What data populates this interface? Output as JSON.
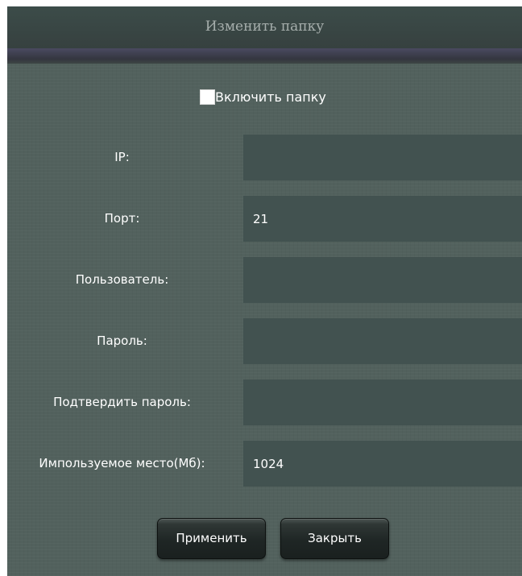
{
  "dialog": {
    "title": "Изменить папку",
    "enable": {
      "label": "Включить папку",
      "checked": false
    },
    "fields": [
      {
        "label": "IP:",
        "value": ""
      },
      {
        "label": "Порт:",
        "value": "21"
      },
      {
        "label": "Пользователь:",
        "value": ""
      },
      {
        "label": "Пароль:",
        "value": ""
      },
      {
        "label": "Подтвердить пароль:",
        "value": ""
      },
      {
        "label": "Импользуемое место(Мб):",
        "value": "1024"
      }
    ],
    "buttons": {
      "apply": "Применить",
      "close": "Закрыть"
    }
  },
  "colors": {
    "panel": "#52615d",
    "titlebar": "#3c4c49",
    "input_bg": "#425250",
    "text": "#ffffff",
    "title_text": "#a6aeac"
  }
}
